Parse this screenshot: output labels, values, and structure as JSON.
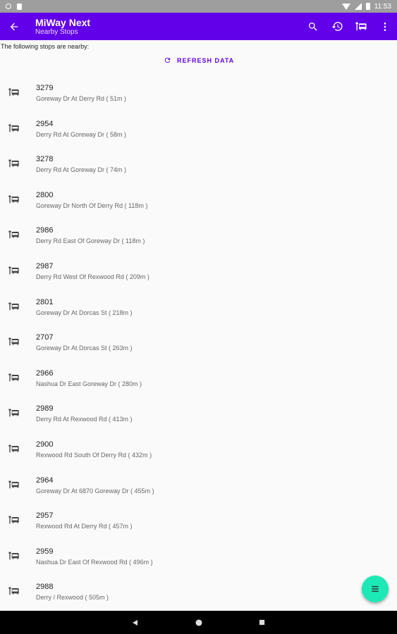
{
  "status_bar": {
    "time": "11:53"
  },
  "app_bar": {
    "title": "MiWay Next",
    "subtitle": "Nearby Stops",
    "actions": [
      "search-icon",
      "history-icon",
      "bus-stop-icon",
      "more-icon"
    ]
  },
  "intro_text": "The following stops are nearby:",
  "refresh_label": "REFRESH DATA",
  "stops": [
    {
      "number": "3279",
      "description": "Goreway Dr At Derry Rd ( 51m )"
    },
    {
      "number": "2954",
      "description": "Derry Rd At Goreway Dr ( 58m )"
    },
    {
      "number": "3278",
      "description": "Derry Rd At Goreway Dr ( 74m )"
    },
    {
      "number": "2800",
      "description": "Goreway Dr North Of Derry Rd ( 118m )"
    },
    {
      "number": "2986",
      "description": "Derry Rd East Of Goreway Dr ( 118m )"
    },
    {
      "number": "2987",
      "description": "Derry Rd West Of Rexwood Rd ( 209m )"
    },
    {
      "number": "2801",
      "description": "Goreway Dr At Dorcas St ( 218m )"
    },
    {
      "number": "2707",
      "description": "Goreway Dr At Dorcas St ( 263m )"
    },
    {
      "number": "2966",
      "description": "Nashua Dr East Goreway Dr ( 280m )"
    },
    {
      "number": "2989",
      "description": "Derry Rd At Rexwood Rd ( 413m )"
    },
    {
      "number": "2900",
      "description": "Rexwood Rd South Of Derry Rd ( 432m )"
    },
    {
      "number": "2964",
      "description": "Goreway Dr At 6870 Goreway Dr ( 455m )"
    },
    {
      "number": "2957",
      "description": "Rexwood Rd At Derry Rd ( 457m )"
    },
    {
      "number": "2959",
      "description": "Nashua Dr East Of Rexwood Rd ( 496m )"
    },
    {
      "number": "2988",
      "description": "Derry / Rexwood ( 505m )"
    }
  ],
  "colors": {
    "primary": "#6200ea",
    "fab": "#1de9b6",
    "status_bar": "#9e9e9e"
  }
}
